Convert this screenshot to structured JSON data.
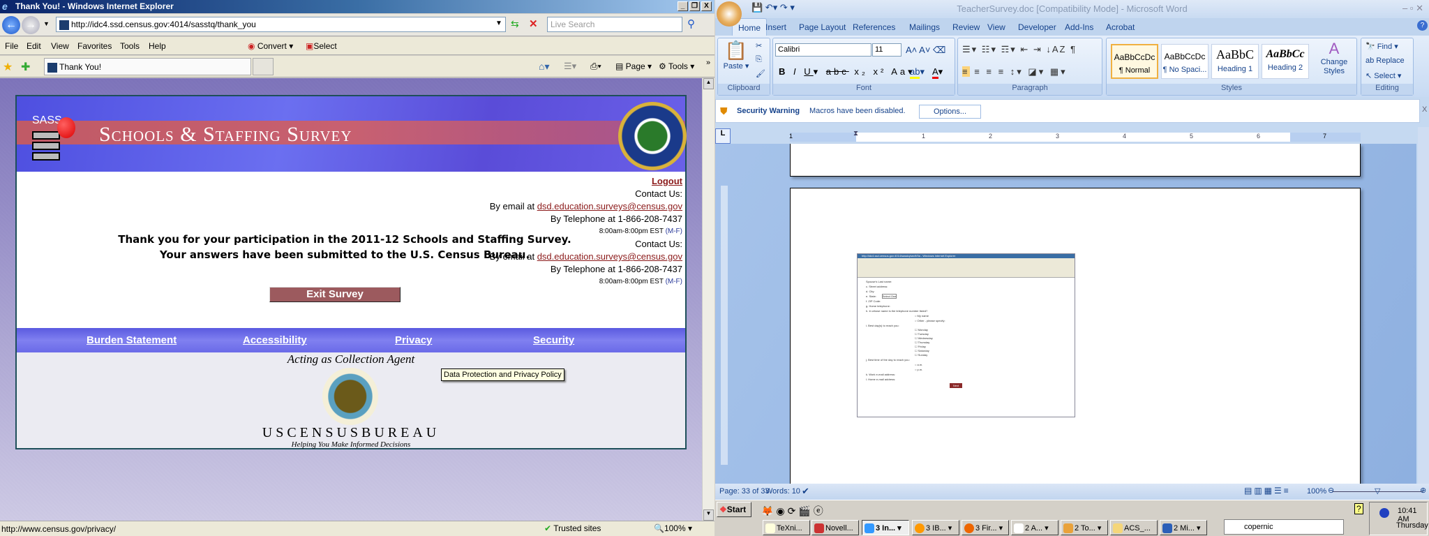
{
  "ie": {
    "title": "Thank You! - Windows Internet Explorer",
    "controls": {
      "minimize": "_",
      "restore": "❐",
      "close": "X"
    },
    "address": "http://idc4.ssd.census.gov:4014/sasstq/thank_you",
    "search_placeholder": "Live Search",
    "menu": [
      "File",
      "Edit",
      "View",
      "Favorites",
      "Tools",
      "Help"
    ],
    "convert_label": "Convert",
    "select_label": "Select",
    "tab_title": "Thank You!",
    "toolbar": {
      "page": "Page",
      "tools": "Tools"
    },
    "status_url": "http://www.census.gov/privacy/",
    "zone": "Trusted sites",
    "zoom": "100%"
  },
  "page": {
    "banner": {
      "sass": "SASS",
      "title": "Schools & Staffing Survey",
      "seal": "Department of Education · United States of America"
    },
    "logout": "Logout",
    "contact_blocks": [
      {
        "heading": "Contact Us:",
        "email_prefix": "By email at ",
        "email": "dsd.education.surveys@census.gov",
        "phone": "By Telephone at 1-866-208-7437",
        "hours": "8:00am-8:00pm EST",
        "days": "(M-F)"
      },
      {
        "heading": "Contact Us:",
        "email_prefix": "By email at ",
        "email": "dsd.education.surveys@census.gov",
        "phone": "By Telephone at 1-866-208-7437",
        "hours": "8:00am-8:00pm EST",
        "days": "(M-F)"
      }
    ],
    "thanks_line1": "Thank you for your participation in the 2011-12 Schools and Staffing Survey.",
    "thanks_line2": "Your answers have been submitted to the U.S. Census Bureau.",
    "exit_button": "Exit Survey",
    "footer_links": [
      "Burden Statement",
      "Accessibility",
      "Privacy",
      "Security"
    ],
    "tooltip": "Data Protection and Privacy Policy",
    "collection_agent": "Acting as Collection Agent",
    "census_seal": "U.S. Department of Commerce · Bureau of the Census",
    "census_name": "USCENSUSBUREAU",
    "census_tagline": "Helping You Make Informed Decisions"
  },
  "word": {
    "title": "TeacherSurvey.doc [Compatibility Mode] - Microsoft Word",
    "tabs": [
      "Home",
      "Insert",
      "Page Layout",
      "References",
      "Mailings",
      "Review",
      "View",
      "Developer",
      "Add-Ins",
      "Acrobat"
    ],
    "clipboard": {
      "paste": "Paste",
      "label": "Clipboard"
    },
    "font": {
      "name": "Calibri",
      "size": "11",
      "label": "Font"
    },
    "paragraph_label": "Paragraph",
    "styles": [
      {
        "sample": "AaBbCcDc",
        "name": "¶ Normal"
      },
      {
        "sample": "AaBbCcDc",
        "name": "¶ No Spaci..."
      },
      {
        "sample": "AaBbC",
        "name": "Heading 1"
      },
      {
        "sample": "AaBbCc",
        "name": "Heading 2"
      }
    ],
    "change_styles": "Change Styles",
    "styles_label": "Styles",
    "editing": {
      "find": "Find",
      "replace": "Replace",
      "select": "Select",
      "label": "Editing"
    },
    "security": {
      "title": "Security Warning",
      "message": "Macros have been disabled.",
      "options": "Options..."
    },
    "ruler_numbers": [
      "1",
      "1",
      "2",
      "3",
      "4",
      "5",
      "6",
      "7"
    ],
    "embedded": {
      "title": "http://idc4.ssd.census.gov:4014/sasstq/sec9/9a - Windows Internet Explorer",
      "fields": [
        "Spouse's Last name:",
        "c. Street address:",
        "d. City:",
        "e. State:",
        "f. ZIP Code:",
        "g. Home telephone:",
        "h. In whose name is the telephone number listed?",
        "i. Best day(s) to reach you:",
        "j. Best time of the day to reach you:",
        "k. Work e-mail address:",
        "l. Home e-mail address:"
      ],
      "state_select": "Select One",
      "radio_h": [
        "My name",
        "Other - please specify:"
      ],
      "days": [
        "Monday",
        "Tuesday",
        "Wednesday",
        "Thursday",
        "Friday",
        "Saturday",
        "Sunday"
      ],
      "times": [
        "a.m.",
        "p.m."
      ],
      "next": "Next"
    },
    "status": {
      "page": "Page: 33 of 33",
      "words": "Words: 10",
      "zoom": "100%"
    }
  },
  "taskbar": {
    "start": "Start",
    "tasks": [
      "TeXni...",
      "Novell...",
      "3 In...",
      "3 IB...",
      "3 Fir...",
      "2 A...",
      "2 To...",
      "ACS_...",
      "2 Mi..."
    ],
    "search": "copernic",
    "time": "10:41 AM",
    "day": "Thursday"
  }
}
